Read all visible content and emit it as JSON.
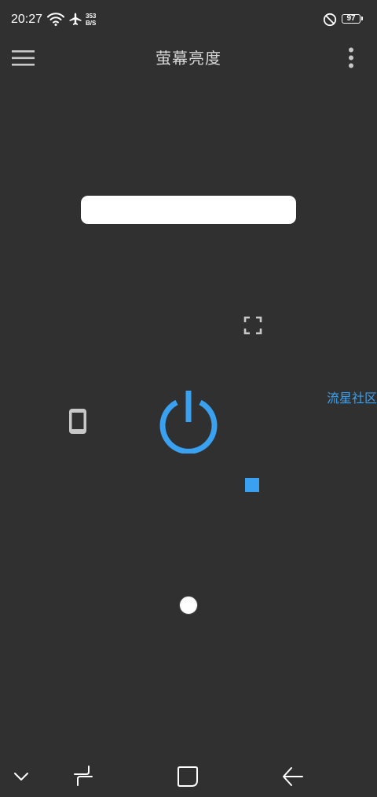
{
  "status_bar": {
    "time": "20:27",
    "net_speed_value": "353",
    "net_speed_unit": "B/S",
    "battery_level": "97",
    "icons": [
      "wifi-icon",
      "airplane-icon",
      "do-not-disturb-icon",
      "battery-icon"
    ]
  },
  "app_bar": {
    "title": "萤幕亮度",
    "menu_icon": "hamburger-menu-icon",
    "more_icon": "more-vertical-icon"
  },
  "main": {
    "side_link_label": "流星社区",
    "power_icon": "power-icon",
    "phone_icon": "phone-icon",
    "fullscreen_icon": "fullscreen-icon"
  },
  "nav_bar": {
    "icons": [
      "chevron-down-icon",
      "recent-apps-icon",
      "home-icon",
      "back-icon"
    ]
  },
  "colors": {
    "background": "#303030",
    "accent": "#3aa0f0",
    "title_text": "#d6d6d6",
    "icon_gray": "#c8c8c8"
  }
}
